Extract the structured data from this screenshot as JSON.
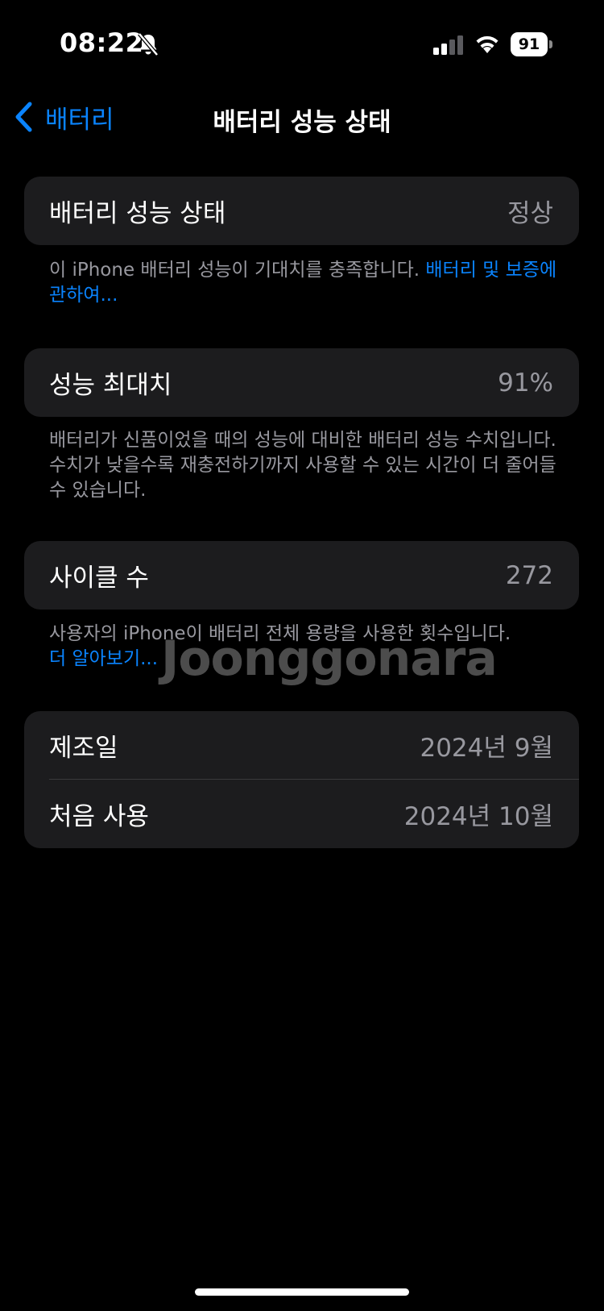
{
  "status_bar": {
    "time": "08:22",
    "battery_level": "91",
    "icons": [
      "bell-slash-icon",
      "cellular-signal-icon",
      "wifi-icon",
      "battery-icon"
    ]
  },
  "nav": {
    "back_label": "배터리",
    "title": "배터리 성능 상태"
  },
  "health": {
    "label": "배터리 성능 상태",
    "value": "정상",
    "footnote": "이 iPhone 배터리 성능이 기대치를 충족합니다. ",
    "link": "배터리 및 보증에 관하여..."
  },
  "capacity": {
    "label": "성능 최대치",
    "value": "91%",
    "footnote": "배터리가 신품이었을 때의 성능에 대비한 배터리 성능 수치입니다. 수치가 낮을수록 재충전하기까지 사용할 수 있는 시간이 더 줄어들 수 있습니다."
  },
  "cycles": {
    "label": "사이클 수",
    "value": "272",
    "footnote": "사용자의 iPhone이 배터리 전체 용량을 사용한 횟수입니다.",
    "link": "더 알아보기..."
  },
  "dates": {
    "manufactured_label": "제조일",
    "manufactured_value": "2024년 9월",
    "first_use_label": "처음 사용",
    "first_use_value": "2024년 10월"
  },
  "watermark": "Joonggonara",
  "colors": {
    "background": "#000000",
    "group_background": "#1c1c1e",
    "accent": "#0a84ff",
    "secondary_text": "#98989f"
  }
}
